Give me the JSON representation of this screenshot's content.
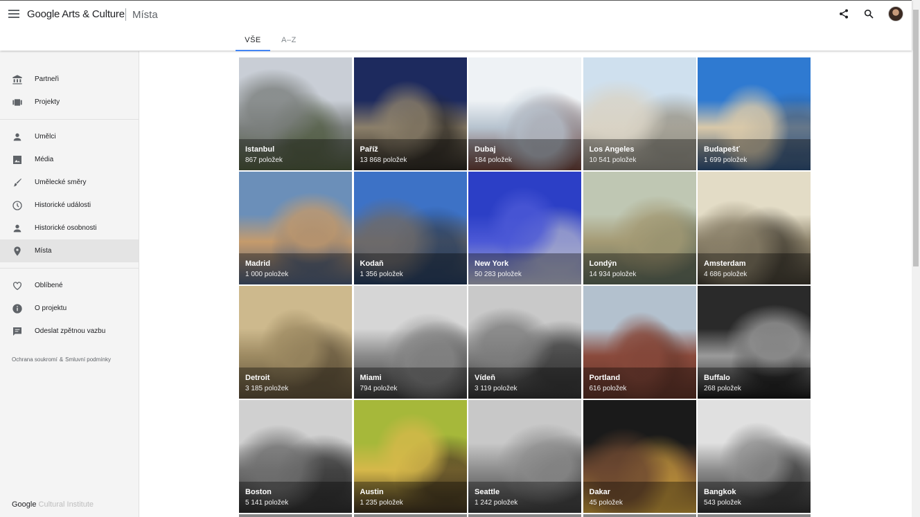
{
  "header": {
    "brand": "Google Arts & Culture",
    "section": "Místa"
  },
  "tabs": [
    {
      "label": "VŠE",
      "active": true
    },
    {
      "label": "A–Z",
      "active": false
    }
  ],
  "sidebar": {
    "group1": [
      {
        "label": "Partneři",
        "icon": "bank-icon"
      },
      {
        "label": "Projekty",
        "icon": "collections-icon"
      }
    ],
    "group2": [
      {
        "label": "Umělci",
        "icon": "person-icon"
      },
      {
        "label": "Média",
        "icon": "image-icon"
      },
      {
        "label": "Umělecké směry",
        "icon": "brush-icon"
      },
      {
        "label": "Historické události",
        "icon": "clock-icon"
      },
      {
        "label": "Historické osobnosti",
        "icon": "person-icon"
      },
      {
        "label": "Místa",
        "icon": "pin-icon",
        "active": true
      }
    ],
    "group3": [
      {
        "label": "Oblíbené",
        "icon": "heart-icon"
      },
      {
        "label": "O projektu",
        "icon": "info-icon"
      },
      {
        "label": "Odeslat zpětnou vazbu",
        "icon": "feedback-icon"
      }
    ],
    "legal": {
      "privacy": "Ochrana soukromí",
      "amp": "&",
      "terms": "Smluvní podmínky"
    },
    "footer": {
      "google": "Google",
      "ci": "Cultural Institute"
    }
  },
  "places": [
    {
      "name": "Istanbul",
      "count": "867 položek",
      "palette": [
        "#c9ced6",
        "#7b7f7d",
        "#4e5a3e"
      ]
    },
    {
      "name": "Paříž",
      "count": "13 868 položek",
      "palette": [
        "#1d2a5e",
        "#8b7f6a",
        "#2a2620"
      ]
    },
    {
      "name": "Dubaj",
      "count": "184 položek",
      "palette": [
        "#eef2f5",
        "#b7c3cf",
        "#6b4038"
      ]
    },
    {
      "name": "Los Angeles",
      "count": "10 541 položek",
      "palette": [
        "#cfe0ee",
        "#d9d3c5",
        "#8c8a80"
      ]
    },
    {
      "name": "Budapešť",
      "count": "1 699 položek",
      "palette": [
        "#2f7ad1",
        "#d8c8a9",
        "#2d4f7a"
      ]
    },
    {
      "name": "Madrid",
      "count": "1 000 položek",
      "palette": [
        "#6b8fb9",
        "#c59b6c",
        "#4a5b78"
      ]
    },
    {
      "name": "Kodaň",
      "count": "1 356 položek",
      "palette": [
        "#3d72c6",
        "#6d6a6a",
        "#243b5d"
      ]
    },
    {
      "name": "New York",
      "count": "50 283 položek",
      "palette": [
        "#2c3fc6",
        "#4c59d6",
        "#b5b8c8"
      ]
    },
    {
      "name": "Londýn",
      "count": "14 934 položek",
      "palette": [
        "#bfc7b3",
        "#a49a74",
        "#5d6a5a"
      ]
    },
    {
      "name": "Amsterdam",
      "count": "4 686 položek",
      "palette": [
        "#e3dcc6",
        "#8a8069",
        "#3f3a30"
      ]
    },
    {
      "name": "Detroit",
      "count": "3 185 položek",
      "palette": [
        "#cdb98d",
        "#9d8a62",
        "#5e5039"
      ]
    },
    {
      "name": "Miami",
      "count": "794 položek",
      "palette": [
        "#d6d6d6",
        "#8a8a8a",
        "#3a3a3a"
      ]
    },
    {
      "name": "Vídeň",
      "count": "3 119 položek",
      "palette": [
        "#c9c9c9",
        "#7d7d7d",
        "#303030"
      ]
    },
    {
      "name": "Portland",
      "count": "616 položek",
      "palette": [
        "#b3c1ce",
        "#8a4a3c",
        "#5e3328"
      ]
    },
    {
      "name": "Buffalo",
      "count": "268 položek",
      "palette": [
        "#2a2a2a",
        "#9a9a9a",
        "#151515"
      ]
    },
    {
      "name": "Boston",
      "count": "5 141 položek",
      "palette": [
        "#d0d0d0",
        "#6f6f6f",
        "#2d2d2d"
      ]
    },
    {
      "name": "Austin",
      "count": "1 235 položek",
      "palette": [
        "#a6b83a",
        "#d6b84a",
        "#3b2f1e"
      ]
    },
    {
      "name": "Seattle",
      "count": "1 242 položek",
      "palette": [
        "#c8c8c8",
        "#8d8d8d",
        "#3a3a3a"
      ]
    },
    {
      "name": "Dakar",
      "count": "45 položek",
      "palette": [
        "#1a1a1a",
        "#6b4730",
        "#c59a3b"
      ]
    },
    {
      "name": "Bangkok",
      "count": "543 položek",
      "palette": [
        "#e0e0e0",
        "#8c8c8c",
        "#2f2f2f"
      ]
    }
  ]
}
